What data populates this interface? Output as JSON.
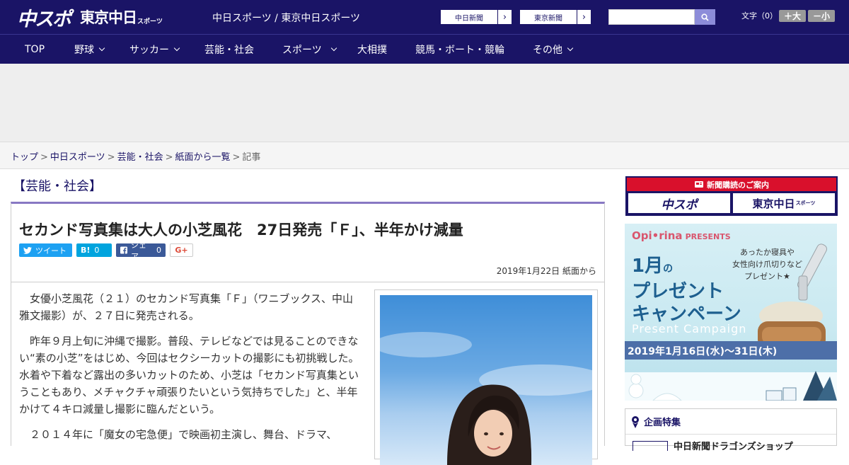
{
  "header": {
    "logo_main": "中スポ",
    "logo_tokyo": "東京中日",
    "logo_tokyo_small": "スポーツ",
    "site_names": "中日スポーツ / 東京中日スポーツ",
    "paper_links": [
      "中日新聞",
      "東京新聞"
    ],
    "search_placeholder": "",
    "font_size_label": "文字（0）",
    "font_bigger": "＋大",
    "font_smaller": "－小"
  },
  "nav": {
    "items": [
      {
        "label": "TOP"
      },
      {
        "label": "野球"
      },
      {
        "label": "サッカー"
      },
      {
        "label": "芸能・社会"
      },
      {
        "label": "スポーツ"
      },
      {
        "label": "大相撲"
      },
      {
        "label": "競馬・ボート・競輪"
      },
      {
        "label": "その他"
      }
    ]
  },
  "breadcrumb": {
    "items": [
      "トップ",
      "中日スポーツ",
      "芸能・社会",
      "紙面から一覧"
    ],
    "current": "記事",
    "separator": ">"
  },
  "article": {
    "section": "【芸能・社会】",
    "title": "セカンド写真集は大人の小芝風花　27日発売「Ｆ」、半年かけ減量",
    "share": {
      "tweet_label": "ツイート",
      "hatena_label": "B!",
      "hatena_count": "0",
      "facebook_label": "シェア",
      "facebook_count": "0",
      "gplus_label": "G+"
    },
    "date": "2019年1月22日 紙面から",
    "paragraphs": [
      "　女優小芝風花（２１）のセカンド写真集「Ｆ」（ワニブックス、中山雅文撮影）が、２７日に発売される。",
      "　昨年９月上旬に沖縄で撮影。普段、テレビなどでは見ることのできない“素の小芝”をはじめ、今回はセクシーカットの撮影にも初挑戦した。水着や下着など露出の多いカットのため、小芝は「セカンド写真集ということもあり、メチャクチャ頑張りたいという気持ちでした」と、半年かけて４キロ減量し撮影に臨んだという。",
      "　２０１４年に「魔女の宅急便」で映画初主演し、舞台、ドラマ、"
    ]
  },
  "sidebar": {
    "subscribe_heading": "新聞購読のご案内",
    "subscribe_logos": [
      "中スポ",
      "東京中日"
    ],
    "subscribe_logo_small": "スポーツ",
    "campaign": {
      "brand": "Opi•rina",
      "brand_suffix": "PRESENTS",
      "gift_lines": [
        "あったか寝具や",
        "女性向け爪切りなど",
        "プレゼント★"
      ],
      "month": "1月",
      "month_suffix": "の",
      "line2": "プレゼント",
      "line3": "キャンペーン",
      "english": "Present Campaign",
      "period": "2019年1月16日(水)〜31日(木)"
    },
    "feature_heading": "企画特集",
    "feature_item": "中日新聞ドラゴンズショップ"
  },
  "colors": {
    "brand_navy": "#1a1466",
    "accent_purple": "#8878c3",
    "twitter": "#1da1f2",
    "hatena": "#00a4de",
    "facebook": "#3b5998",
    "subscribe_red": "#d9102c"
  }
}
